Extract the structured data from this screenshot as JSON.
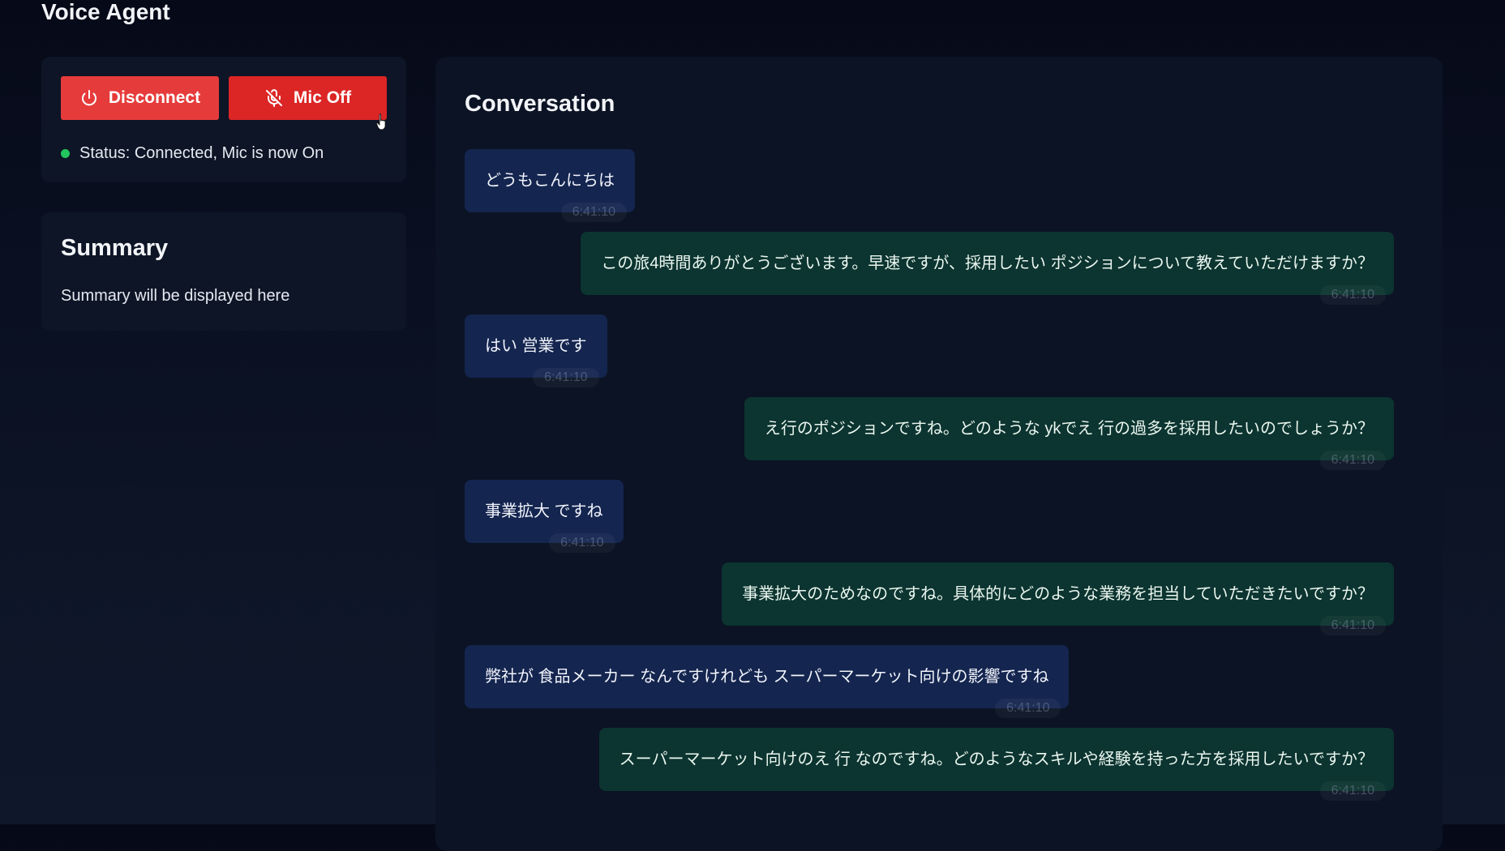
{
  "app": {
    "title": "Voice Agent"
  },
  "controls": {
    "disconnect_label": "Disconnect",
    "mic_label": "Mic Off",
    "status_text": "Status: Connected, Mic is now On",
    "status_color": "#22c55e",
    "button_color": "#e23737"
  },
  "summary": {
    "title": "Summary",
    "text": "Summary will be displayed here"
  },
  "conversation": {
    "title": "Conversation",
    "messages": [
      {
        "role": "user",
        "text": "どうもこんにちは",
        "time": "6:41:10"
      },
      {
        "role": "agent",
        "text": "この旅4時間ありがとうございます。早速ですが、採用したい ポジションについて教えていただけますか？",
        "time": "6:41:10"
      },
      {
        "role": "user",
        "text": "はい 営業です",
        "time": "6:41:10"
      },
      {
        "role": "agent",
        "text": "え行のポジションですね。どのような ykでえ 行の過多を採用したいのでしょうか？",
        "time": "6:41:10"
      },
      {
        "role": "user",
        "text": "事業拡大 ですね",
        "time": "6:41:10"
      },
      {
        "role": "agent",
        "text": "事業拡大のためなのですね。具体的にどのような業務を担当していただきたいですか？",
        "time": "6:41:10"
      },
      {
        "role": "user",
        "text": "弊社が 食品メーカー なんですけれども スーパーマーケット向けの影響ですね",
        "time": "6:41:10"
      },
      {
        "role": "agent",
        "text": "スーパーマーケット向けのえ 行 なのですね。どのようなスキルや経験を持った方を採用したいですか？",
        "time": "6:41:10"
      }
    ]
  },
  "icons": {
    "disconnect": "power-icon",
    "mic": "mic-off-icon",
    "cursor": "pointer-cursor-icon"
  }
}
